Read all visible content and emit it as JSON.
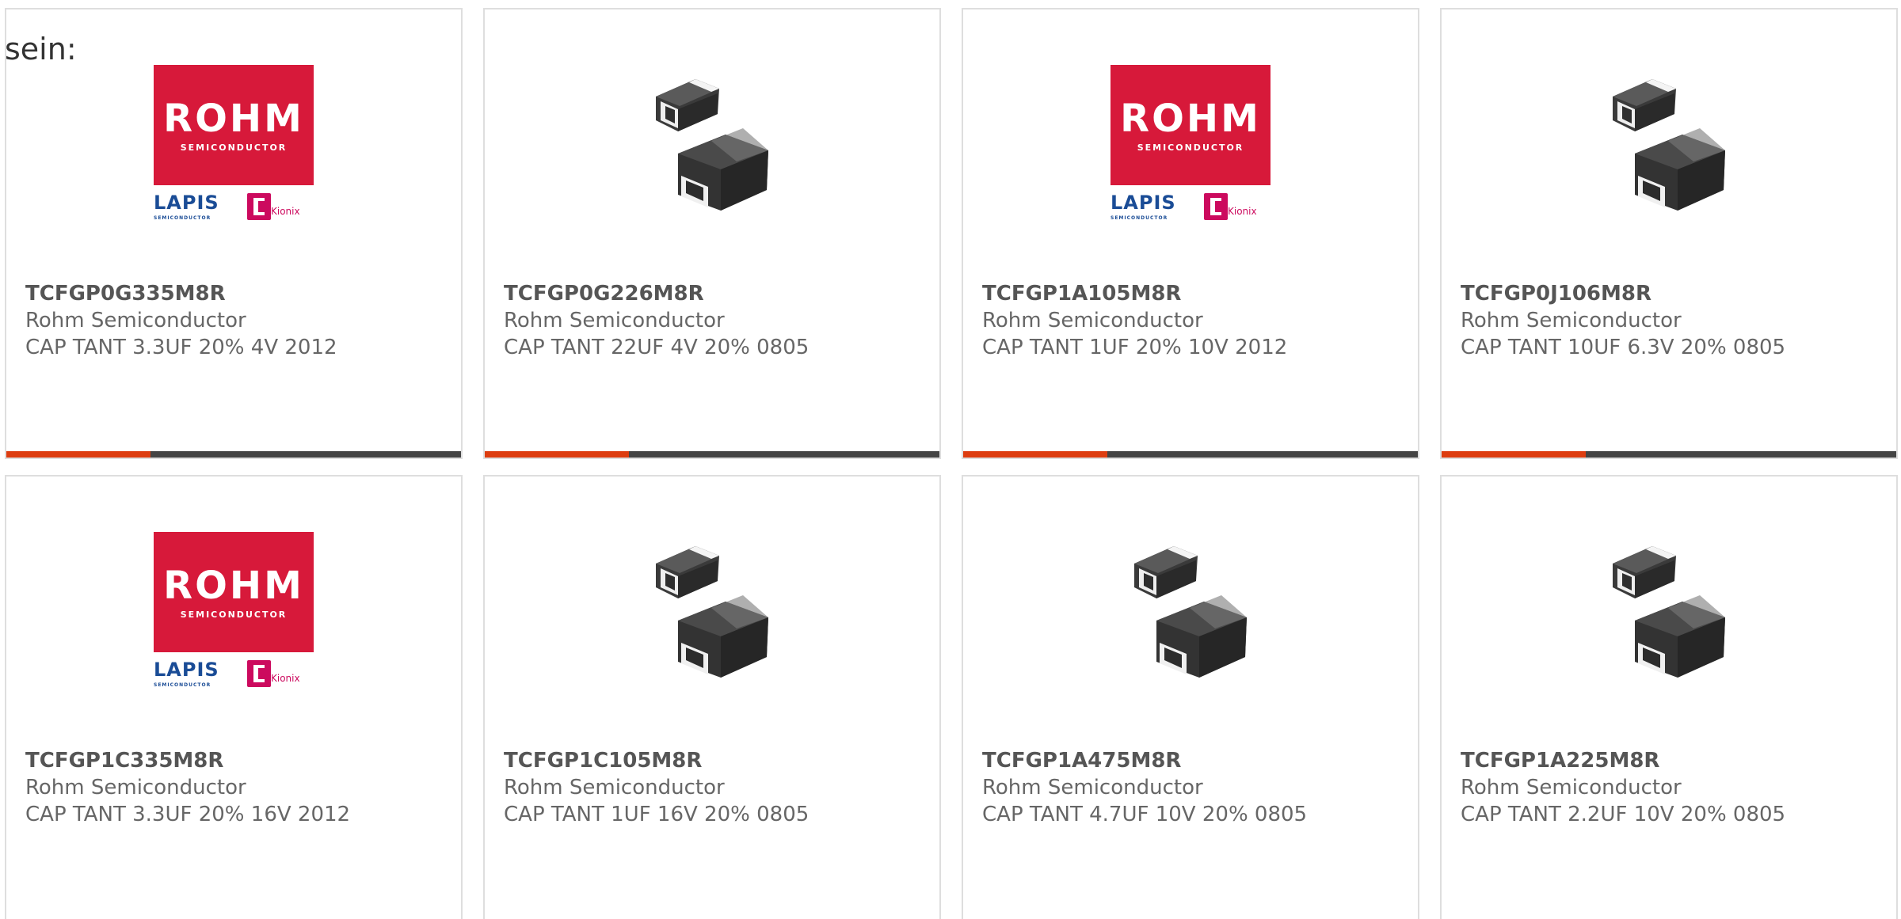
{
  "intro": {
    "text": "sein:"
  },
  "colors": {
    "card_border": "#dedede",
    "accent_orange": "#dd3d10",
    "accent_dark": "#444444",
    "part_number": "#555555",
    "body_text": "#666666",
    "rohm_red": "#d7193a",
    "lapis_blue": "#1a4c96",
    "kionix_pink": "#cc0a5e"
  },
  "logo": {
    "rohm_word": "ROHM",
    "rohm_sub": "SEMICONDUCTOR",
    "lapis_word": "LAPIS",
    "lapis_sub": "SEMICONDUCTOR",
    "kionix_word": "Kionix"
  },
  "products": [
    {
      "image": "rohm-logo",
      "part_number": "TCFGP0G335M8R",
      "manufacturer": "Rohm Semiconductor",
      "description": "CAP TANT 3.3UF 20% 4V 2012"
    },
    {
      "image": "tantalum-capacitor",
      "part_number": "TCFGP0G226M8R",
      "manufacturer": "Rohm Semiconductor",
      "description": "CAP TANT 22UF 4V 20% 0805"
    },
    {
      "image": "rohm-logo",
      "part_number": "TCFGP1A105M8R",
      "manufacturer": "Rohm Semiconductor",
      "description": "CAP TANT 1UF 20% 10V 2012"
    },
    {
      "image": "tantalum-capacitor",
      "part_number": "TCFGP0J106M8R",
      "manufacturer": "Rohm Semiconductor",
      "description": "CAP TANT 10UF 6.3V 20% 0805"
    },
    {
      "image": "rohm-logo",
      "part_number": "TCFGP1C335M8R",
      "manufacturer": "Rohm Semiconductor",
      "description": "CAP TANT 3.3UF 20% 16V 2012"
    },
    {
      "image": "tantalum-capacitor",
      "part_number": "TCFGP1C105M8R",
      "manufacturer": "Rohm Semiconductor",
      "description": "CAP TANT 1UF 16V 20% 0805"
    },
    {
      "image": "tantalum-capacitor",
      "part_number": "TCFGP1A475M8R",
      "manufacturer": "Rohm Semiconductor",
      "description": "CAP TANT 4.7UF 10V 20% 0805"
    },
    {
      "image": "tantalum-capacitor",
      "part_number": "TCFGP1A225M8R",
      "manufacturer": "Rohm Semiconductor",
      "description": "CAP TANT 2.2UF 10V 20% 0805"
    }
  ]
}
